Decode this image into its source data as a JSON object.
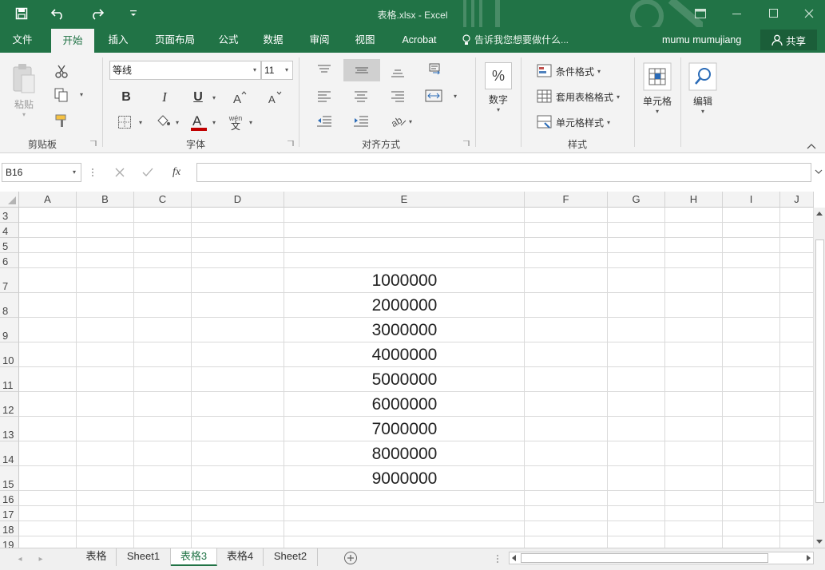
{
  "window": {
    "title": "表格.xlsx - Excel"
  },
  "tabs": [
    "文件",
    "开始",
    "插入",
    "页面布局",
    "公式",
    "数据",
    "审阅",
    "视图",
    "Acrobat"
  ],
  "active_tab": "开始",
  "tell_me": "告诉我您想要做什么...",
  "user_name": "mumu mumujiang",
  "share_label": "共享",
  "ribbon": {
    "clipboard": {
      "paste_label": "粘贴",
      "group_label": "剪贴板"
    },
    "font": {
      "name": "等线",
      "size": "11",
      "group_label": "字体",
      "bold": "B",
      "italic": "I",
      "underline": "U",
      "wen_top": "wén",
      "wen_bottom": "文"
    },
    "alignment": {
      "group_label": "对齐方式"
    },
    "number": {
      "percent": "%",
      "label": "数字"
    },
    "styles": {
      "conditional": "条件格式",
      "table_format": "套用表格格式",
      "cell_styles": "单元格样式",
      "group_label": "样式"
    },
    "cells": {
      "label": "单元格"
    },
    "editing": {
      "label": "编辑"
    }
  },
  "formula_bar": {
    "name_box": "B16",
    "fx": "fx",
    "content": ""
  },
  "grid": {
    "columns": [
      "A",
      "B",
      "C",
      "D",
      "E",
      "F",
      "G",
      "H",
      "I",
      "J"
    ],
    "rows": [
      "3",
      "4",
      "5",
      "6",
      "7",
      "8",
      "9",
      "10",
      "11",
      "12",
      "13",
      "14",
      "15",
      "16",
      "17",
      "18",
      "19"
    ],
    "values_E": [
      "1000000",
      "2000000",
      "3000000",
      "4000000",
      "5000000",
      "6000000",
      "7000000",
      "8000000",
      "9000000"
    ]
  },
  "sheet_tabs": [
    "表格",
    "Sheet1",
    "表格3",
    "表格4",
    "Sheet2"
  ],
  "active_sheet": "表格3",
  "colors": {
    "accent": "#217346",
    "ribbon_bg": "#f3f3f3"
  }
}
